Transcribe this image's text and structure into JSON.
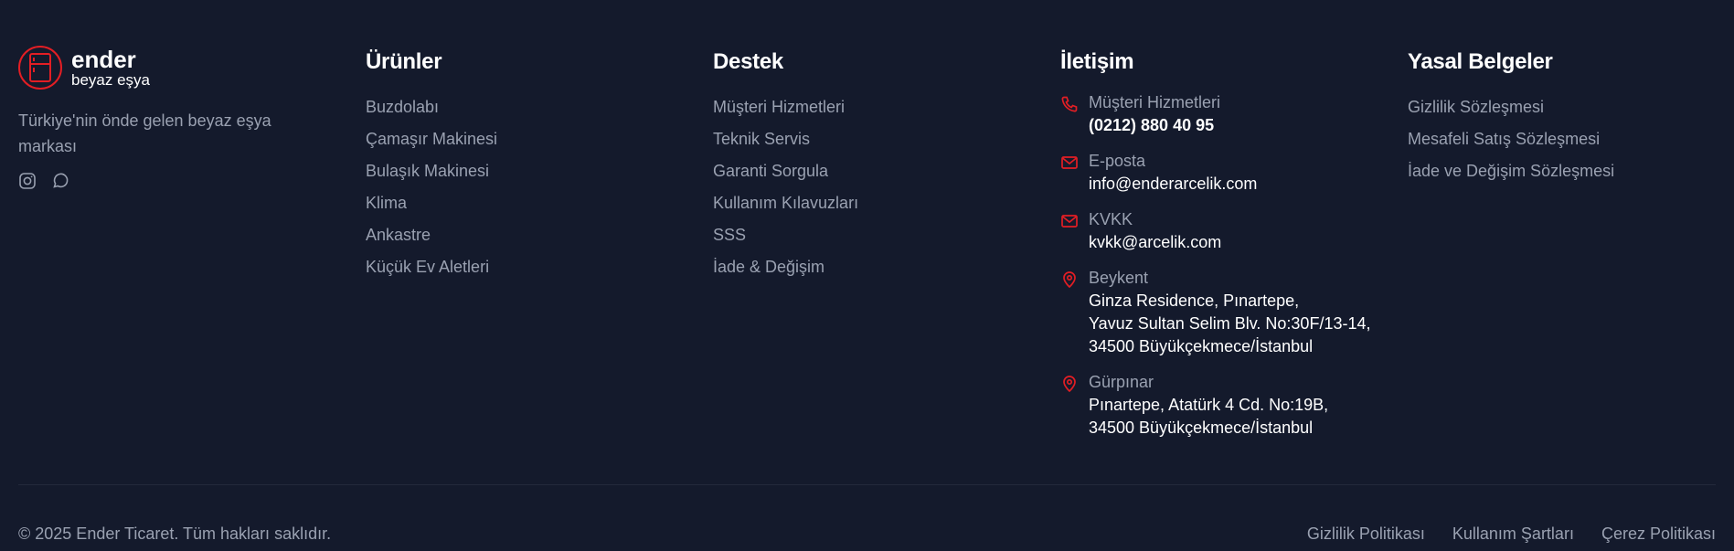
{
  "brand": {
    "name": "ender",
    "sub": "beyaz eşya",
    "tagline": "Türkiye'nin önde gelen beyaz eşya markası",
    "accent_color": "#e31e24",
    "socials": [
      "instagram-icon",
      "whatsapp-icon"
    ]
  },
  "columns": {
    "products": {
      "title": "Ürünler",
      "items": [
        "Buzdolabı",
        "Çamaşır Makinesi",
        "Bulaşık Makinesi",
        "Klima",
        "Ankastre",
        "Küçük Ev Aletleri"
      ]
    },
    "support": {
      "title": "Destek",
      "items": [
        "Müşteri Hizmetleri",
        "Teknik Servis",
        "Garanti Sorgula",
        "Kullanım Kılavuzları",
        "SSS",
        "İade & Değişim"
      ]
    },
    "contact": {
      "title": "İletişim",
      "items": [
        {
          "icon": "phone-icon",
          "label": "Müşteri Hizmetleri",
          "lines": [
            "(0212) 880 40 95"
          ]
        },
        {
          "icon": "mail-icon",
          "label": "E-posta",
          "lines": [
            "info@enderarcelik.com"
          ]
        },
        {
          "icon": "mail-icon",
          "label": "KVKK",
          "lines": [
            "kvkk@arcelik.com"
          ]
        },
        {
          "icon": "map-pin-icon",
          "label": "Beykent",
          "lines": [
            "Ginza Residence, Pınartepe,",
            "Yavuz Sultan Selim Blv. No:30F/13-14,",
            "34500 Büyükçekmece/İstanbul"
          ]
        },
        {
          "icon": "map-pin-icon",
          "label": "Gürpınar",
          "lines": [
            "Pınartepe, Atatürk 4 Cd. No:19B,",
            "34500 Büyükçekmece/İstanbul"
          ]
        }
      ]
    },
    "legal": {
      "title": "Yasal Belgeler",
      "items": [
        "Gizlilik Sözleşmesi",
        "Mesafeli Satış Sözleşmesi",
        "İade ve Değişim Sözleşmesi"
      ]
    }
  },
  "footer": {
    "copyright": "© 2025 Ender Ticaret. Tüm hakları saklıdır.",
    "links": [
      "Gizlilik Politikası",
      "Kullanım Şartları",
      "Çerez Politikası"
    ]
  }
}
